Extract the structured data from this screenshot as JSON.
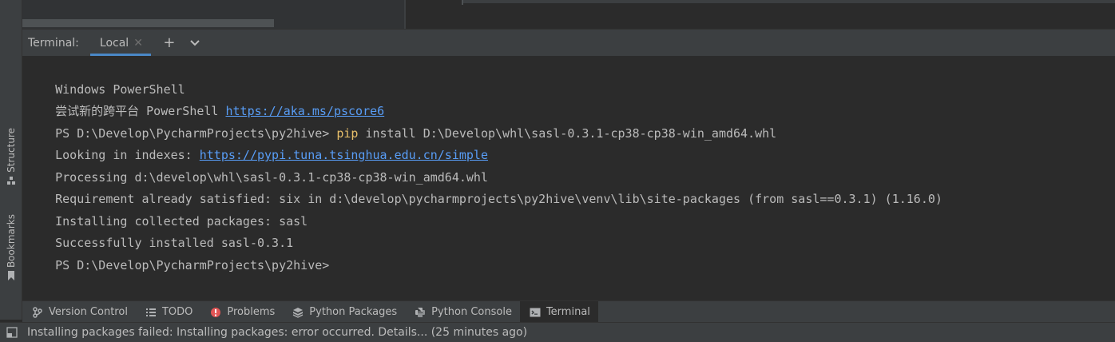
{
  "sidebar": {
    "items": [
      {
        "label": "Structure",
        "icon": "structure-icon"
      },
      {
        "label": "Bookmarks",
        "icon": "bookmark-icon"
      }
    ]
  },
  "terminal": {
    "title": "Terminal:",
    "tab_label": "Local",
    "add_icon": "plus-icon",
    "more_icon": "chevron-down-icon",
    "lines": {
      "l1": "Windows PowerShell",
      "l2_text": "尝试新的跨平台 PowerShell ",
      "l2_link": "https://aka.ms/pscore6",
      "l3_prompt": "PS D:\\Develop\\PycharmProjects\\py2hive> ",
      "l3_cmd": "pip",
      "l3_args": " install D:\\Develop\\whl\\sasl-0.3.1-cp38-cp38-win_amd64.whl",
      "l4_text": "Looking in indexes: ",
      "l4_link": "https://pypi.tuna.tsinghua.edu.cn/simple",
      "l5": "Processing d:\\develop\\whl\\sasl-0.3.1-cp38-cp38-win_amd64.whl",
      "l6": "Requirement already satisfied: six in d:\\develop\\pycharmprojects\\py2hive\\venv\\lib\\site-packages (from sasl==0.3.1) (1.16.0)",
      "l7": "Installing collected packages: sasl",
      "l8": "Successfully installed sasl-0.3.1",
      "l9": "PS D:\\Develop\\PycharmProjects\\py2hive>"
    }
  },
  "toolbar": {
    "items": [
      {
        "label": "Version Control",
        "icon": "version-control-icon"
      },
      {
        "label": "TODO",
        "icon": "todo-icon"
      },
      {
        "label": "Problems",
        "icon": "problems-icon"
      },
      {
        "label": "Python Packages",
        "icon": "python-packages-icon"
      },
      {
        "label": "Python Console",
        "icon": "python-console-icon"
      },
      {
        "label": "Terminal",
        "icon": "terminal-icon"
      }
    ],
    "active": "Terminal"
  },
  "status": {
    "message": "Installing packages failed: Installing packages: error occurred. Details... (25 minutes ago)",
    "icon": "layout-icon"
  },
  "colors": {
    "background": "#2b2b2b",
    "panel": "#3c3f41",
    "link": "#589df6",
    "command": "#e8bf6a",
    "accent": "#4a88c7",
    "error": "#e05555"
  }
}
